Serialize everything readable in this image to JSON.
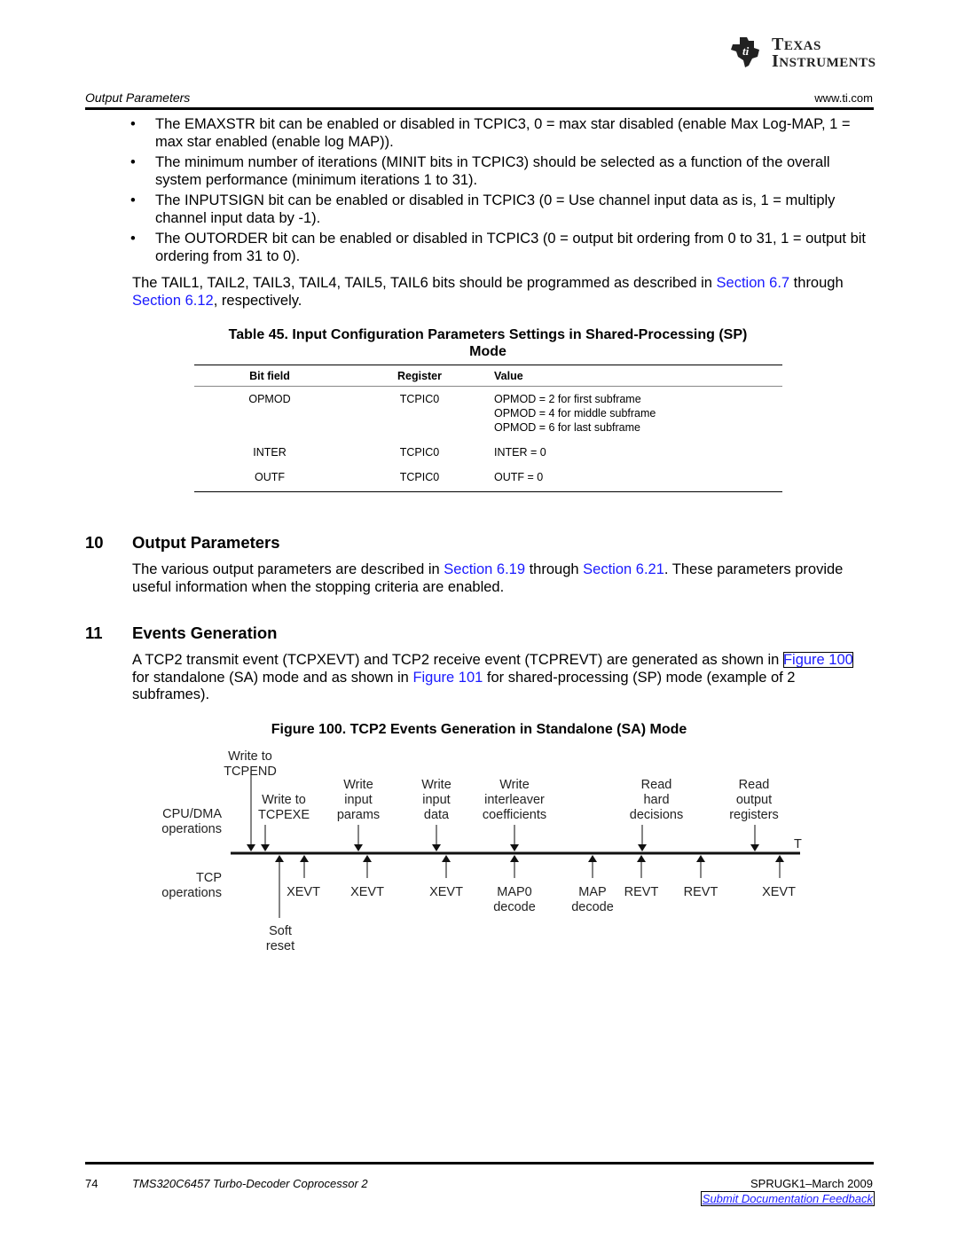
{
  "header": {
    "brand_line1": "Texas",
    "brand_line2": "Instruments",
    "section_title": "Output Parameters",
    "url": "www.ti.com"
  },
  "bullets": [
    "The EMAXSTR bit can be enabled or disabled in TCPIC3, 0 = max star disabled (enable Max Log-MAP, 1 = max star enabled (enable log MAP)).",
    "The minimum number of iterations (MINIT bits in TCPIC3) should be selected as a function of the overall system performance (minimum iterations 1 to 31).",
    "The INPUTSIGN bit can be enabled or disabled in TCPIC3 (0 = Use channel input data as is, 1 = multiply channel input data by -1).",
    "The OUTORDER bit can be enabled or disabled in TCPIC3 (0 = output bit ordering from 0 to 31, 1 = output bit ordering from 31 to 0)."
  ],
  "bullet_glyph": "•",
  "tail_para": {
    "pre": "The TAIL1, TAIL2, TAIL3, TAIL4, TAIL5, TAIL6 bits should be programmed as described in ",
    "link1": "Section 6.7",
    "mid": " through ",
    "link2": "Section 6.12",
    "post": ", respectively."
  },
  "table45": {
    "title_line1": "Table 45. Input Configuration Parameters Settings in Shared-Processing (SP)",
    "title_line2": "Mode",
    "headers": [
      "Bit field",
      "Register",
      "Value"
    ],
    "rows": [
      {
        "field": "OPMOD",
        "register": "TCPIC0",
        "values": [
          "OPMOD = 2 for first subframe",
          "OPMOD = 4 for middle subframe",
          "OPMOD = 6 for last subframe"
        ]
      },
      {
        "field": "INTER",
        "register": "TCPIC0",
        "values": [
          "INTER = 0"
        ]
      },
      {
        "field": "OUTF",
        "register": "TCPIC0",
        "values": [
          "OUTF = 0"
        ]
      }
    ]
  },
  "section10": {
    "number": "10",
    "title": "Output Parameters",
    "pre": "The various output parameters are described in ",
    "link1": "Section 6.19",
    "mid": " through ",
    "link2": "Section 6.21",
    "post": ". These parameters provide useful information when the stopping criteria are enabled."
  },
  "section11": {
    "number": "11",
    "title": "Events Generation",
    "pre": "A TCP2 transmit event (TCPXEVT) and TCP2 receive event (TCPREVT) are generated as shown in ",
    "link1": "Figure 100",
    "mid": " for standalone (SA) mode and as shown in ",
    "link2": "Figure 101",
    "post": " for shared-processing (SP) mode (example of 2 subframes)."
  },
  "figure100": {
    "title": "Figure 100. TCP2 Events Generation in Standalone (SA) Mode",
    "row_label_cpu": [
      "CPU/DMA",
      "operations"
    ],
    "row_label_tcp": [
      "TCP",
      "operations"
    ],
    "time_label": "T",
    "cpu_events": [
      {
        "label": [
          "Write to",
          "TCPEND"
        ]
      },
      {
        "label": [
          "Write to",
          "TCPEXE"
        ]
      },
      {
        "label": [
          "Write",
          "input",
          "params"
        ]
      },
      {
        "label": [
          "Write",
          "input",
          "data"
        ]
      },
      {
        "label": [
          "Write",
          "interleaver",
          "coefficients"
        ]
      },
      {
        "label": [
          "Read",
          "hard",
          "decisions"
        ]
      },
      {
        "label": [
          "Read",
          "output",
          "registers"
        ]
      }
    ],
    "tcp_events": [
      {
        "label": [
          "Soft",
          "reset"
        ]
      },
      {
        "label": [
          "XEVT"
        ]
      },
      {
        "label": [
          "XEVT"
        ]
      },
      {
        "label": [
          "XEVT"
        ]
      },
      {
        "label": [
          "MAP0",
          "decode"
        ]
      },
      {
        "label": [
          "MAP",
          "decode"
        ]
      },
      {
        "label": [
          "REVT"
        ]
      },
      {
        "label": [
          "REVT"
        ]
      },
      {
        "label": [
          "XEVT"
        ]
      }
    ]
  },
  "footer": {
    "page_number": "74",
    "doc_title": "TMS320C6457 Turbo-Decoder Coprocessor 2",
    "doc_id": "SPRUGK1–March 2009",
    "feedback_link": "Submit Documentation Feedback"
  }
}
